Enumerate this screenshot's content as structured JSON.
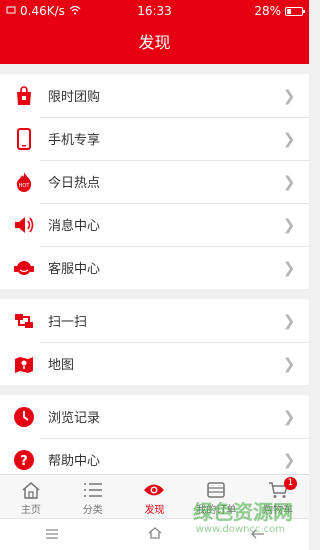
{
  "status_bar": {
    "speed": "0.46K/s",
    "time": "16:33",
    "battery": "28%"
  },
  "header": {
    "title": "发现"
  },
  "groups": [
    {
      "items": [
        {
          "label": "限时团购",
          "icon": "shopping-bag-icon"
        },
        {
          "label": "手机专享",
          "icon": "phone-icon"
        },
        {
          "label": "今日热点",
          "icon": "fire-icon"
        },
        {
          "label": "消息中心",
          "icon": "speaker-icon"
        },
        {
          "label": "客服中心",
          "icon": "headset-icon"
        }
      ]
    },
    {
      "items": [
        {
          "label": "扫一扫",
          "icon": "scan-icon"
        },
        {
          "label": "地图",
          "icon": "map-icon"
        }
      ]
    },
    {
      "items": [
        {
          "label": "浏览记录",
          "icon": "clock-icon"
        },
        {
          "label": "帮助中心",
          "icon": "help-icon"
        }
      ]
    }
  ],
  "tabs": [
    {
      "label": "主页",
      "icon": "home-icon"
    },
    {
      "label": "分类",
      "icon": "list-icon"
    },
    {
      "label": "发现",
      "icon": "eye-icon",
      "active": true
    },
    {
      "label": "我的订单",
      "icon": "box-icon"
    },
    {
      "label": "购物车",
      "icon": "cart-icon",
      "badge": "1"
    }
  ],
  "accent_color": "#e60012",
  "watermark": {
    "text": "绿色资源网",
    "url": "www.downcc.com"
  }
}
